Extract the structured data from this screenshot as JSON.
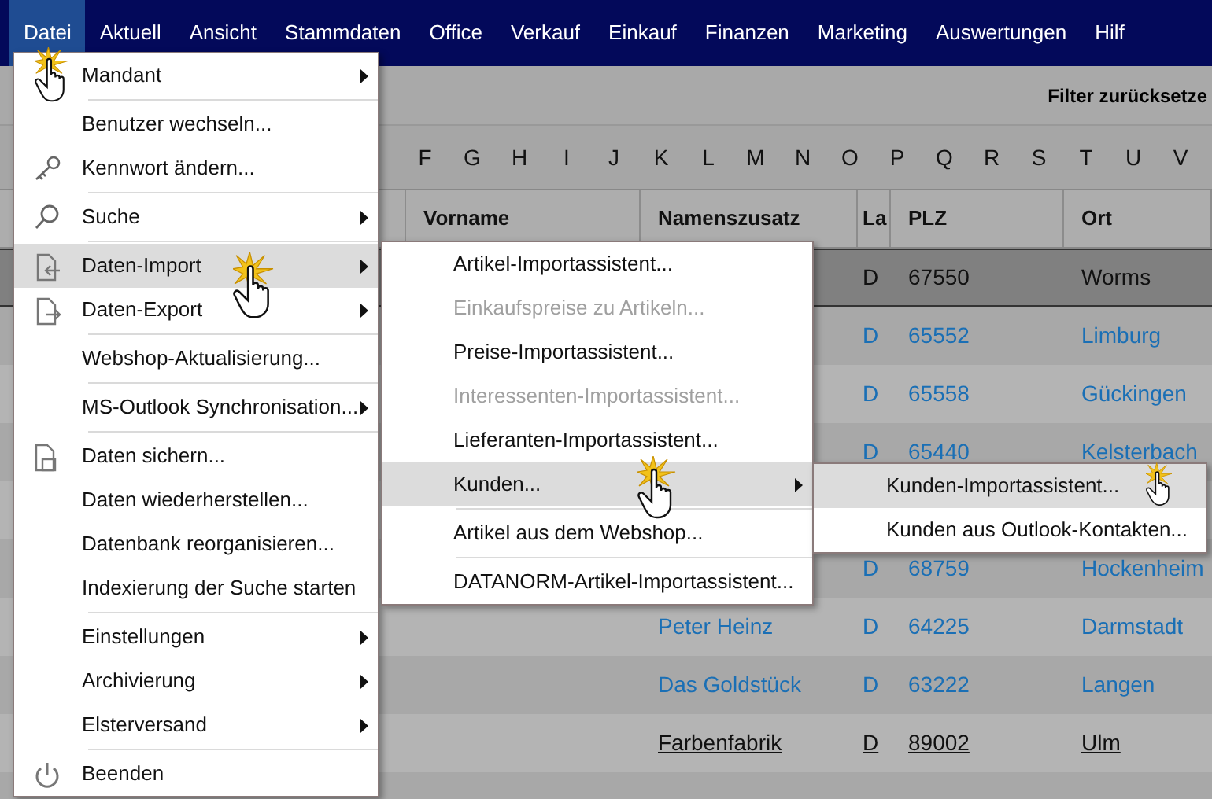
{
  "menubar": [
    {
      "label": "Datei",
      "selected": true
    },
    {
      "label": "Aktuell",
      "selected": false
    },
    {
      "label": "Ansicht",
      "selected": false
    },
    {
      "label": "Stammdaten",
      "selected": false
    },
    {
      "label": "Office",
      "selected": false
    },
    {
      "label": "Verkauf",
      "selected": false
    },
    {
      "label": "Einkauf",
      "selected": false
    },
    {
      "label": "Finanzen",
      "selected": false
    },
    {
      "label": "Marketing",
      "selected": false
    },
    {
      "label": "Auswertungen",
      "selected": false
    },
    {
      "label": "Hilf",
      "selected": false
    }
  ],
  "toolbar": {
    "filter_button": "Filter zurücksetze"
  },
  "letters": [
    "F",
    "G",
    "H",
    "I",
    "J",
    "K",
    "L",
    "M",
    "N",
    "O",
    "P",
    "Q",
    "R",
    "S",
    "T",
    "U",
    "V"
  ],
  "table": {
    "columns": [
      "Vorname",
      "Namenszusatz",
      "La",
      "PLZ",
      "Ort"
    ],
    "rows": [
      {
        "kind": "data",
        "la": "D",
        "plz": "67550",
        "ort": "Worms",
        "selected": true,
        "hovered": false
      },
      {
        "kind": "data",
        "la": "D",
        "plz": "65552",
        "ort": "Limburg",
        "selected": false,
        "hovered": false
      },
      {
        "kind": "data",
        "la": "D",
        "plz": "65558",
        "ort": "Gückingen",
        "selected": false,
        "hovered": false
      },
      {
        "kind": "data",
        "la": "D",
        "plz": "65440",
        "ort": "Kelsterbach",
        "selected": false,
        "hovered": false
      },
      {
        "kind": "blank"
      },
      {
        "kind": "data",
        "la": "D",
        "plz": "68759",
        "ort": "Hockenheim",
        "selected": false,
        "hovered": false
      },
      {
        "kind": "data",
        "namenszusatz": "Peter Heinz",
        "la": "D",
        "plz": "64225",
        "ort": "Darmstadt",
        "selected": false,
        "hovered": false
      },
      {
        "kind": "data",
        "namenszusatz": "Das Goldstück",
        "la": "D",
        "plz": "63222",
        "ort": "Langen",
        "selected": false,
        "hovered": false
      },
      {
        "kind": "data",
        "namenszusatz": "Farbenfabrik",
        "la": "D",
        "plz": "89002",
        "ort": "Ulm",
        "selected": false,
        "hovered": true
      },
      {
        "kind": "blank"
      }
    ]
  },
  "file_menu": {
    "items": [
      {
        "kind": "item",
        "label": "Mandant",
        "submenu": true,
        "selected": false,
        "disabled": false
      },
      {
        "kind": "separator"
      },
      {
        "kind": "item",
        "label": "Benutzer wechseln...",
        "submenu": false,
        "selected": false,
        "disabled": false
      },
      {
        "kind": "item",
        "label": "Kennwort ändern...",
        "submenu": false,
        "selected": false,
        "disabled": false
      },
      {
        "kind": "separator"
      },
      {
        "kind": "item",
        "label": "Suche",
        "submenu": true,
        "selected": false,
        "disabled": false
      },
      {
        "kind": "separator"
      },
      {
        "kind": "item",
        "label": "Daten-Import",
        "submenu": true,
        "selected": true,
        "disabled": false
      },
      {
        "kind": "item",
        "label": "Daten-Export",
        "submenu": true,
        "selected": false,
        "disabled": false
      },
      {
        "kind": "separator"
      },
      {
        "kind": "item",
        "label": "Webshop-Aktualisierung...",
        "submenu": false,
        "selected": false,
        "disabled": false
      },
      {
        "kind": "separator"
      },
      {
        "kind": "item",
        "label": "MS-Outlook Synchronisation...",
        "submenu": true,
        "selected": false,
        "disabled": false
      },
      {
        "kind": "separator"
      },
      {
        "kind": "item",
        "label": "Daten sichern...",
        "submenu": false,
        "selected": false,
        "disabled": false
      },
      {
        "kind": "item",
        "label": "Daten wiederherstellen...",
        "submenu": false,
        "selected": false,
        "disabled": false
      },
      {
        "kind": "item",
        "label": "Datenbank reorganisieren...",
        "submenu": false,
        "selected": false,
        "disabled": false
      },
      {
        "kind": "item",
        "label": "Indexierung der Suche starten",
        "submenu": false,
        "selected": false,
        "disabled": false
      },
      {
        "kind": "separator"
      },
      {
        "kind": "item",
        "label": "Einstellungen",
        "submenu": true,
        "selected": false,
        "disabled": false
      },
      {
        "kind": "item",
        "label": "Archivierung",
        "submenu": true,
        "selected": false,
        "disabled": false
      },
      {
        "kind": "item",
        "label": "Elsterversand",
        "submenu": true,
        "selected": false,
        "disabled": false
      },
      {
        "kind": "separator"
      },
      {
        "kind": "item",
        "label": "Beenden",
        "submenu": false,
        "selected": false,
        "disabled": false
      }
    ]
  },
  "import_menu": {
    "items": [
      {
        "kind": "item",
        "label": "Artikel-Importassistent...",
        "submenu": false,
        "selected": false,
        "disabled": false
      },
      {
        "kind": "item",
        "label": "Einkaufspreise zu Artikeln...",
        "submenu": false,
        "selected": false,
        "disabled": true
      },
      {
        "kind": "item",
        "label": "Preise-Importassistent...",
        "submenu": false,
        "selected": false,
        "disabled": false
      },
      {
        "kind": "item",
        "label": "Interessenten-Importassistent...",
        "submenu": false,
        "selected": false,
        "disabled": true
      },
      {
        "kind": "item",
        "label": "Lieferanten-Importassistent...",
        "submenu": false,
        "selected": false,
        "disabled": false
      },
      {
        "kind": "item",
        "label": "Kunden...",
        "submenu": true,
        "selected": true,
        "disabled": false
      },
      {
        "kind": "separator"
      },
      {
        "kind": "item",
        "label": "Artikel aus dem Webshop...",
        "submenu": false,
        "selected": false,
        "disabled": false
      },
      {
        "kind": "separator"
      },
      {
        "kind": "item",
        "label": "DATANORM-Artikel-Importassistent...",
        "submenu": false,
        "selected": false,
        "disabled": false
      }
    ]
  },
  "customer_menu": {
    "items": [
      {
        "kind": "item",
        "label": "Kunden-Importassistent...",
        "submenu": false,
        "selected": true,
        "disabled": false
      },
      {
        "kind": "item",
        "label": "Kunden aus Outlook-Kontakten...",
        "submenu": false,
        "selected": false,
        "disabled": false
      }
    ]
  }
}
